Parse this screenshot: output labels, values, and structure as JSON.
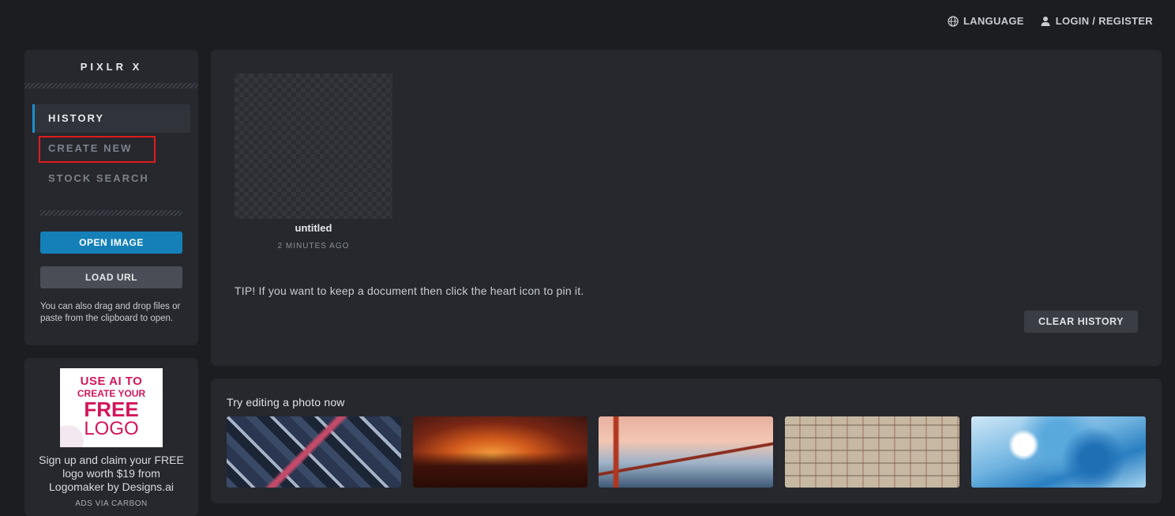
{
  "topnav": {
    "language_label": "LANGUAGE",
    "login_label": "LOGIN / REGISTER"
  },
  "sidebar": {
    "brand": "PIXLR X",
    "items": [
      {
        "label": "HISTORY",
        "active": true
      },
      {
        "label": "CREATE NEW",
        "active": false
      },
      {
        "label": "STOCK SEARCH",
        "active": false
      }
    ],
    "open_image_label": "OPEN IMAGE",
    "load_url_label": "LOAD URL",
    "hint": "You can also drag and drop files or paste from the clipboard to open."
  },
  "ad": {
    "image_line1": "USE AI TO",
    "image_line2": "CREATE YOUR",
    "image_line3": "FREE",
    "image_line4": "LOGO",
    "text": "Sign up and claim your FREE logo worth $19 from Logomaker by Designs.ai",
    "via": "ADS VIA CARBON"
  },
  "history": {
    "documents": [
      {
        "name": "untitled",
        "time": "2 MINUTES AGO"
      }
    ],
    "tip": "TIP! If you want to keep a document then click the heart icon to pin it.",
    "clear_label": "CLEAR HISTORY"
  },
  "photos": {
    "title": "Try editing a photo now"
  },
  "colors": {
    "accent": "#1a8fce",
    "primary_button": "#1580b8",
    "background": "#1c1d21",
    "panel": "#26282e",
    "highlight": "#e01b1b"
  }
}
